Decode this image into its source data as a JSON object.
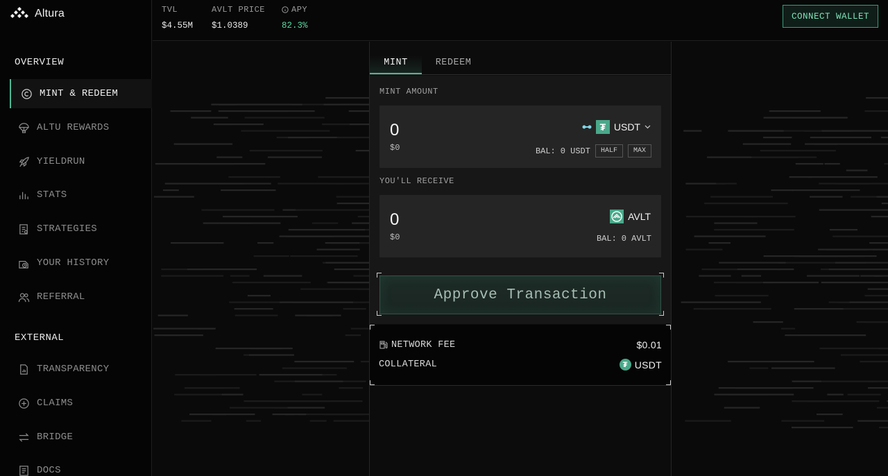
{
  "brand": {
    "name": "Altura"
  },
  "topbar": {
    "stats": [
      {
        "label": "TVL",
        "value": "$4.55M"
      },
      {
        "label": "AVLT PRICE",
        "value": "$1.0389"
      },
      {
        "label": "APY",
        "value": "82.3%",
        "icon": "info-icon"
      }
    ],
    "connect_label": "CONNECT WALLET"
  },
  "sidebar": {
    "overview_title": "OVERVIEW",
    "overview_items": [
      {
        "label": "MINT & REDEEM",
        "icon": "copyright-icon",
        "active": true
      },
      {
        "label": "ALTU REWARDS",
        "icon": "parachute-icon"
      },
      {
        "label": "YIELDRUN",
        "icon": "rocket-icon"
      },
      {
        "label": "STATS",
        "icon": "bar-chart-icon"
      },
      {
        "label": "STRATEGIES",
        "icon": "strategy-icon"
      },
      {
        "label": "YOUR HISTORY",
        "icon": "history-icon"
      },
      {
        "label": "REFERRAL",
        "icon": "users-icon"
      }
    ],
    "external_title": "EXTERNAL",
    "external_items": [
      {
        "label": "TRANSPARENCY",
        "icon": "document-chart-icon"
      },
      {
        "label": "CLAIMS",
        "icon": "plus-circle-icon"
      },
      {
        "label": "BRIDGE",
        "icon": "swap-arrows-icon"
      },
      {
        "label": "DOCS",
        "icon": "docs-icon"
      }
    ]
  },
  "panel": {
    "tabs": {
      "mint": "MINT",
      "redeem": "REDEEM"
    },
    "mint_amount_label": "MINT AMOUNT",
    "input": {
      "amount": "0",
      "usd": "$0",
      "token": "USDT",
      "bal_label": "BAL:",
      "bal_value": "0 USDT",
      "half": "HALF",
      "max": "MAX"
    },
    "receive_label": "YOU'LL RECEIVE",
    "output": {
      "amount": "0",
      "usd": "$0",
      "token": "AVLT",
      "bal_label": "BAL:",
      "bal_value": "0 AVLT"
    },
    "approve_label": "Approve Transaction",
    "network_fee_label": "NETWORK FEE",
    "network_fee_value": "$0.01",
    "collateral_label": "COLLATERAL",
    "collateral_value": "USDT"
  },
  "colors": {
    "accent": "#4db894",
    "background": "#0a0a0a",
    "token_green": "#4aa88a"
  }
}
